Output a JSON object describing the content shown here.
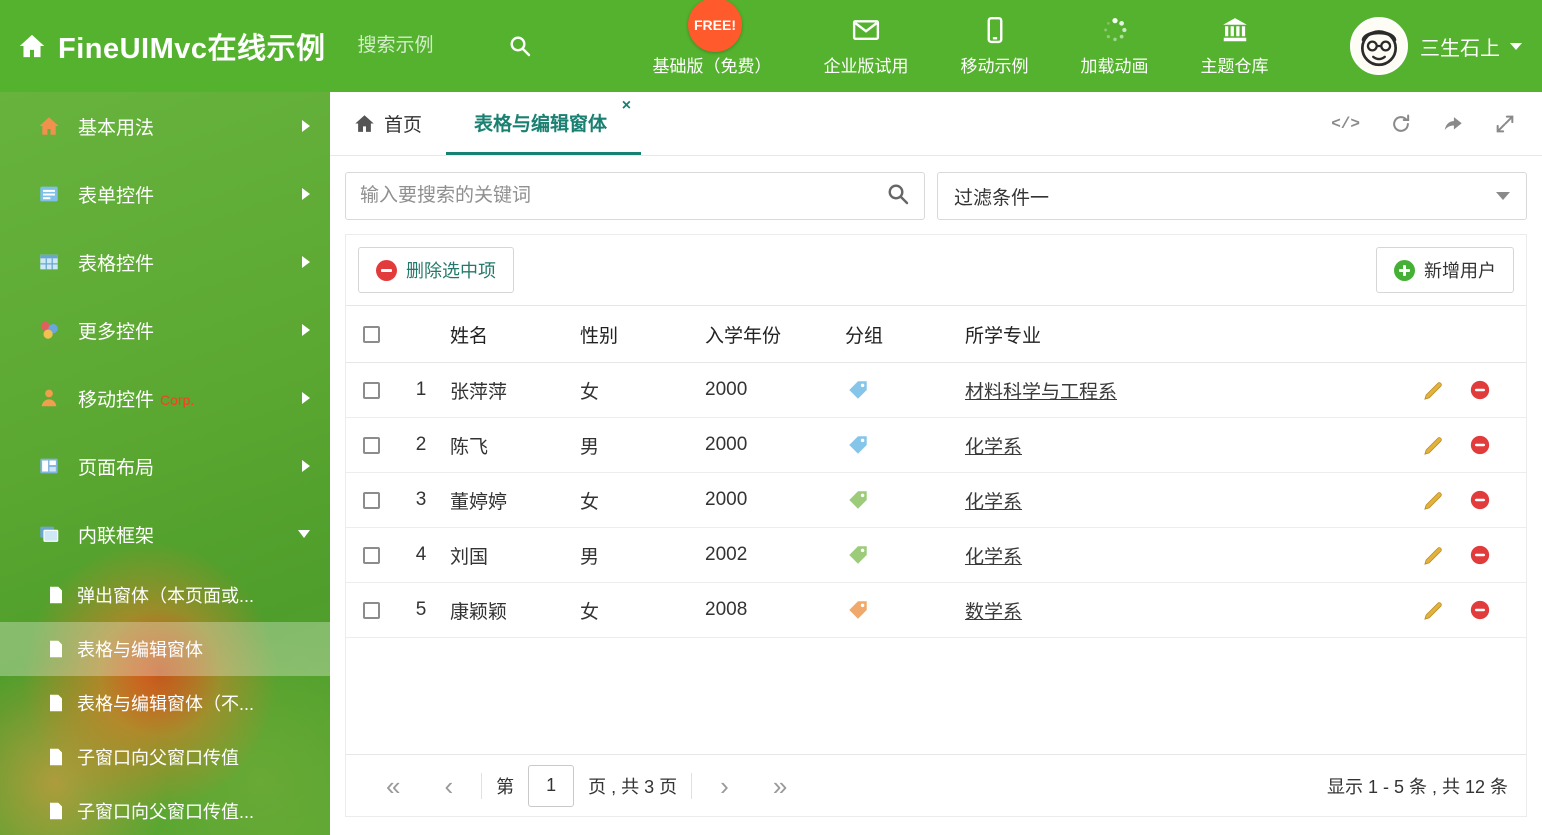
{
  "header": {
    "title": "FineUIMvc在线示例",
    "search_placeholder": "搜索示例",
    "free_badge": "FREE!",
    "nav": [
      {
        "label": "基础版（免费）",
        "icon": "download-icon"
      },
      {
        "label": "企业版试用",
        "icon": "mail-icon"
      },
      {
        "label": "移动示例",
        "icon": "phone-icon"
      },
      {
        "label": "加载动画",
        "icon": "spinner-icon"
      },
      {
        "label": "主题仓库",
        "icon": "bank-icon"
      }
    ],
    "user_name": "三生石上"
  },
  "sidebar": {
    "items": [
      {
        "label": "基本用法"
      },
      {
        "label": "表单控件"
      },
      {
        "label": "表格控件"
      },
      {
        "label": "更多控件"
      },
      {
        "label": "移动控件",
        "badge": "Corp."
      },
      {
        "label": "页面布局"
      },
      {
        "label": "内联框架"
      }
    ],
    "subitems": [
      {
        "label": "弹出窗体（本页面或..."
      },
      {
        "label": "表格与编辑窗体"
      },
      {
        "label": "表格与编辑窗体（不..."
      },
      {
        "label": "子窗口向父窗口传值"
      },
      {
        "label": "子窗口向父窗口传值..."
      }
    ]
  },
  "tabs": {
    "home": "首页",
    "active": "表格与编辑窗体",
    "close": "×",
    "code_icon": "</>"
  },
  "filters": {
    "keyword_placeholder": "输入要搜索的关键词",
    "filter_value": "过滤条件一"
  },
  "toolbar": {
    "delete_label": "删除选中项",
    "add_label": "新增用户"
  },
  "table": {
    "columns": [
      "姓名",
      "性别",
      "入学年份",
      "分组",
      "所学专业"
    ],
    "rows": [
      {
        "num": "1",
        "name": "张萍萍",
        "gender": "女",
        "year": "2000",
        "tag_color": "#86c5ea",
        "major": "材料科学与工程系"
      },
      {
        "num": "2",
        "name": "陈飞",
        "gender": "男",
        "year": "2000",
        "tag_color": "#86c5ea",
        "major": "化学系"
      },
      {
        "num": "3",
        "name": "董婷婷",
        "gender": "女",
        "year": "2000",
        "tag_color": "#9ccb7a",
        "major": "化学系"
      },
      {
        "num": "4",
        "name": "刘国",
        "gender": "男",
        "year": "2002",
        "tag_color": "#9ccb7a",
        "major": "化学系"
      },
      {
        "num": "5",
        "name": "康颖颖",
        "gender": "女",
        "year": "2008",
        "tag_color": "#f0a96a",
        "major": "数学系"
      }
    ]
  },
  "pagination": {
    "first": "«",
    "prev": "‹",
    "page_prefix": "第",
    "page_value": "1",
    "page_suffix": "页 , 共 3 页",
    "next": "›",
    "last": "»",
    "summary": "显示 1 - 5 条 , 共 12 条"
  },
  "colors": {
    "accent": "#1a8071",
    "header_green": "#54b22e",
    "danger": "#e23b3b",
    "success": "#45b035"
  }
}
